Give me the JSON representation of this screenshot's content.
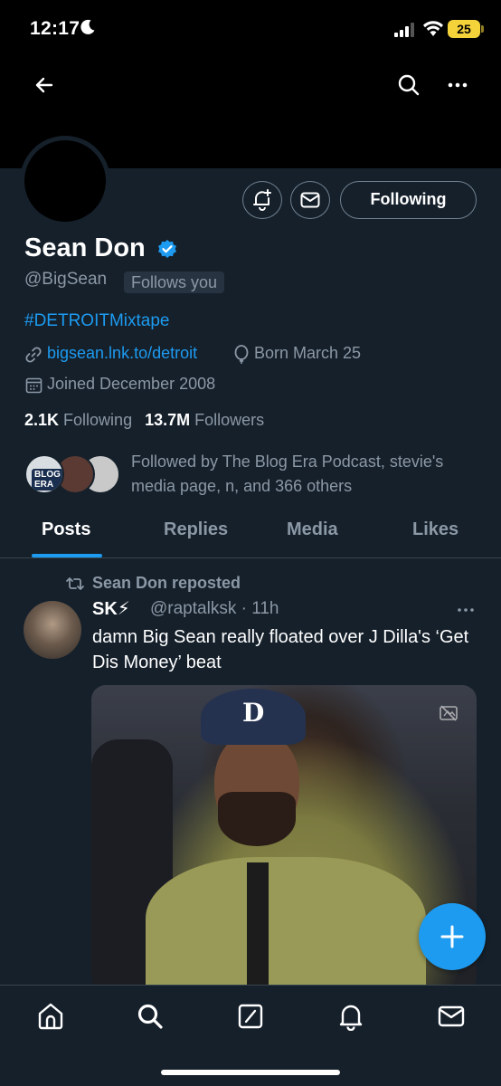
{
  "status_bar": {
    "time": "12:17",
    "battery": "25"
  },
  "icons": {
    "moon": "moon-icon",
    "signal": "signal-icon",
    "wifi": "wifi-icon",
    "back": "back-arrow-icon",
    "search": "search-icon",
    "more": "more-icon"
  },
  "profile": {
    "name": "Sean Don",
    "handle": "@BigSean",
    "follows_you": "Follows you",
    "bio": "#DETROITMixtape",
    "link": "bigsean.lnk.to/detroit",
    "born": "Born March 25",
    "joined": "Joined December 2008",
    "following_count": "2.1K",
    "following_label": "Following",
    "followers_count": "13.7M",
    "followers_label": "Followers",
    "followed_by": "Followed by The Blog Era Podcast, stevie's media page, n, and 366 others",
    "follower_avatar_1_text": "BLOG ERA",
    "follow_button": "Following"
  },
  "tabs": [
    {
      "label": "Posts",
      "active": true
    },
    {
      "label": "Replies",
      "active": false
    },
    {
      "label": "Media",
      "active": false
    },
    {
      "label": "Likes",
      "active": false
    }
  ],
  "post": {
    "repost_label": "Sean Don reposted",
    "author_name": "SK⚡",
    "author_handle": "@raptalksk · 11h",
    "text": "damn Big Sean really floated over J Dilla's ‘Get Dis Money’ beat",
    "media_cap_logo": "D"
  },
  "colors": {
    "background": "#15202b",
    "accent": "#1d9bf0",
    "secondary_text": "#8b98a5",
    "battery": "#f4d23a"
  }
}
